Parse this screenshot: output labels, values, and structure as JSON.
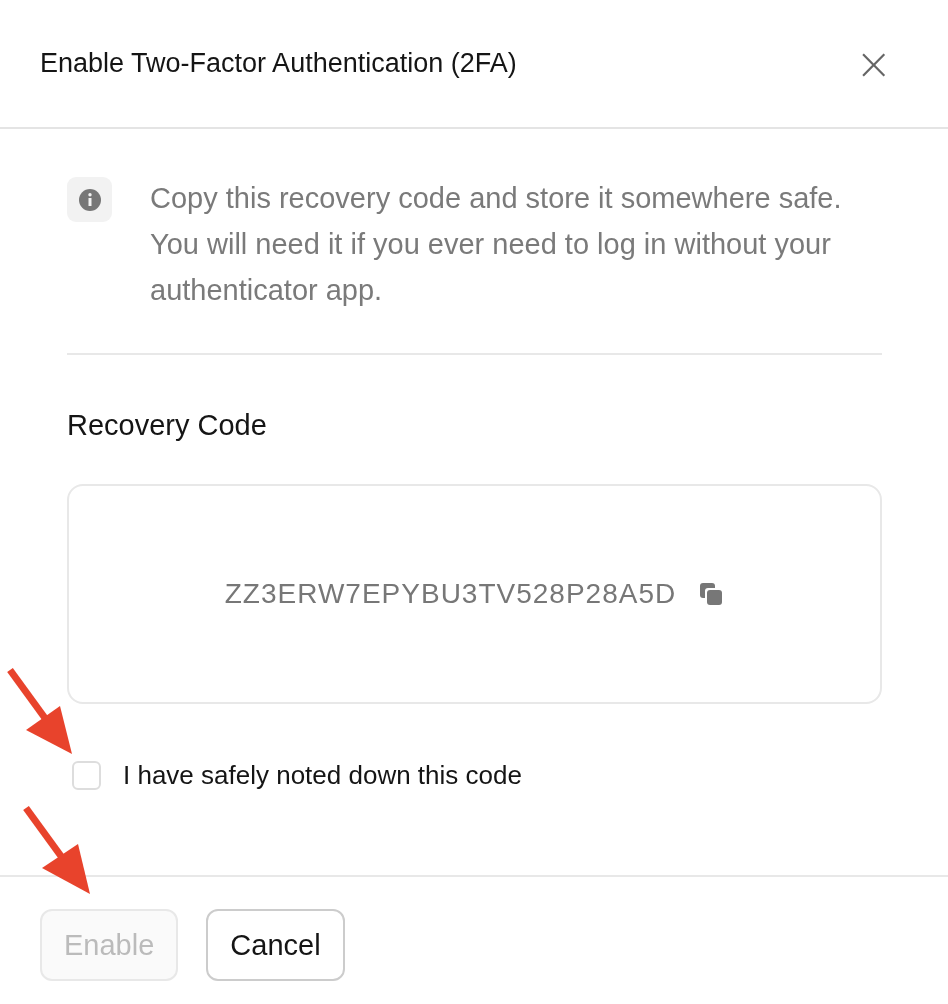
{
  "dialog": {
    "title": "Enable Two-Factor Authentication (2FA)",
    "close_label": "×"
  },
  "notice": {
    "text": "Copy this recovery code and store it somewhere safe. You will need it if you ever need to log in without your authenticator app."
  },
  "recovery": {
    "label": "Recovery Code",
    "code": "ZZ3ERW7EPYBU3TV528P28A5D"
  },
  "confirm": {
    "label": "I have safely noted down this code",
    "checked": false
  },
  "buttons": [
    {
      "label": "Enable",
      "disabled": true
    },
    {
      "label": "Cancel",
      "disabled": false
    }
  ]
}
